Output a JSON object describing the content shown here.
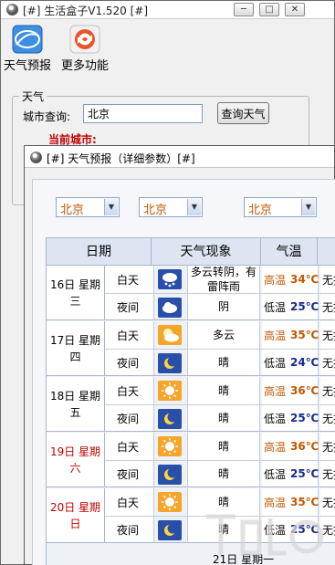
{
  "main_window": {
    "title": "[#] 生活盒子V1.520 [#]",
    "toolbar": [
      {
        "label": "天气预报",
        "icon": "weather-forecast-icon"
      },
      {
        "label": "更多功能",
        "icon": "more-functions-icon"
      }
    ],
    "group_title": "天气",
    "city_label": "城市查询:",
    "city_value": "北京",
    "query_button": "查询天气",
    "current_city_label": "当前城市:"
  },
  "detail_window": {
    "title": "[#] 天气预报（详细参数）[#]",
    "selects": [
      "北京",
      "北京",
      "北京"
    ],
    "headers": {
      "date": "日期",
      "weather": "天气现象",
      "temp": "气温"
    },
    "days": [
      {
        "date": "16日 星期三",
        "weekend": false,
        "day": {
          "label": "白天",
          "icon": "rain-snow-icon",
          "desc": "多云转阴，有雷阵雨",
          "temp_label": "高温",
          "temp": "34℃",
          "wind": "无持"
        },
        "night": {
          "label": "夜间",
          "icon": "cloudy-night-icon",
          "desc": "阴",
          "temp_label": "低温",
          "temp": "25℃",
          "wind": "无持"
        }
      },
      {
        "date": "17日 星期四",
        "weekend": false,
        "day": {
          "label": "白天",
          "icon": "partly-cloudy-icon",
          "desc": "多云",
          "temp_label": "高温",
          "temp": "35℃",
          "wind": "无持"
        },
        "night": {
          "label": "夜间",
          "icon": "moon-icon",
          "desc": "晴",
          "temp_label": "低温",
          "temp": "24℃",
          "wind": "无持"
        }
      },
      {
        "date": "18日 星期五",
        "weekend": false,
        "day": {
          "label": "白天",
          "icon": "sun-icon",
          "desc": "晴",
          "temp_label": "高温",
          "temp": "36℃",
          "wind": "无持"
        },
        "night": {
          "label": "夜间",
          "icon": "moon-icon",
          "desc": "晴",
          "temp_label": "低温",
          "temp": "25℃",
          "wind": "无持"
        }
      },
      {
        "date": "19日 星期六",
        "weekend": true,
        "day": {
          "label": "白天",
          "icon": "sun-icon",
          "desc": "晴",
          "temp_label": "高温",
          "temp": "36℃",
          "wind": "无持"
        },
        "night": {
          "label": "夜间",
          "icon": "moon-icon",
          "desc": "晴",
          "temp_label": "低温",
          "temp": "25℃",
          "wind": "无持"
        }
      },
      {
        "date": "20日 星期日",
        "weekend": true,
        "day": {
          "label": "白天",
          "icon": "sun-icon",
          "desc": "晴",
          "temp_label": "高温",
          "temp": "35℃",
          "wind": "无持"
        },
        "night": {
          "label": "夜间",
          "icon": "moon-icon",
          "desc": "晴",
          "temp_label": "低温",
          "temp": "25℃",
          "wind": "无持"
        }
      }
    ],
    "next_day": "21日 星期一"
  },
  "colors": {
    "accent_orange": "#c05800",
    "weekend_red": "#c00000",
    "night_blue": "#1a2a8a"
  }
}
